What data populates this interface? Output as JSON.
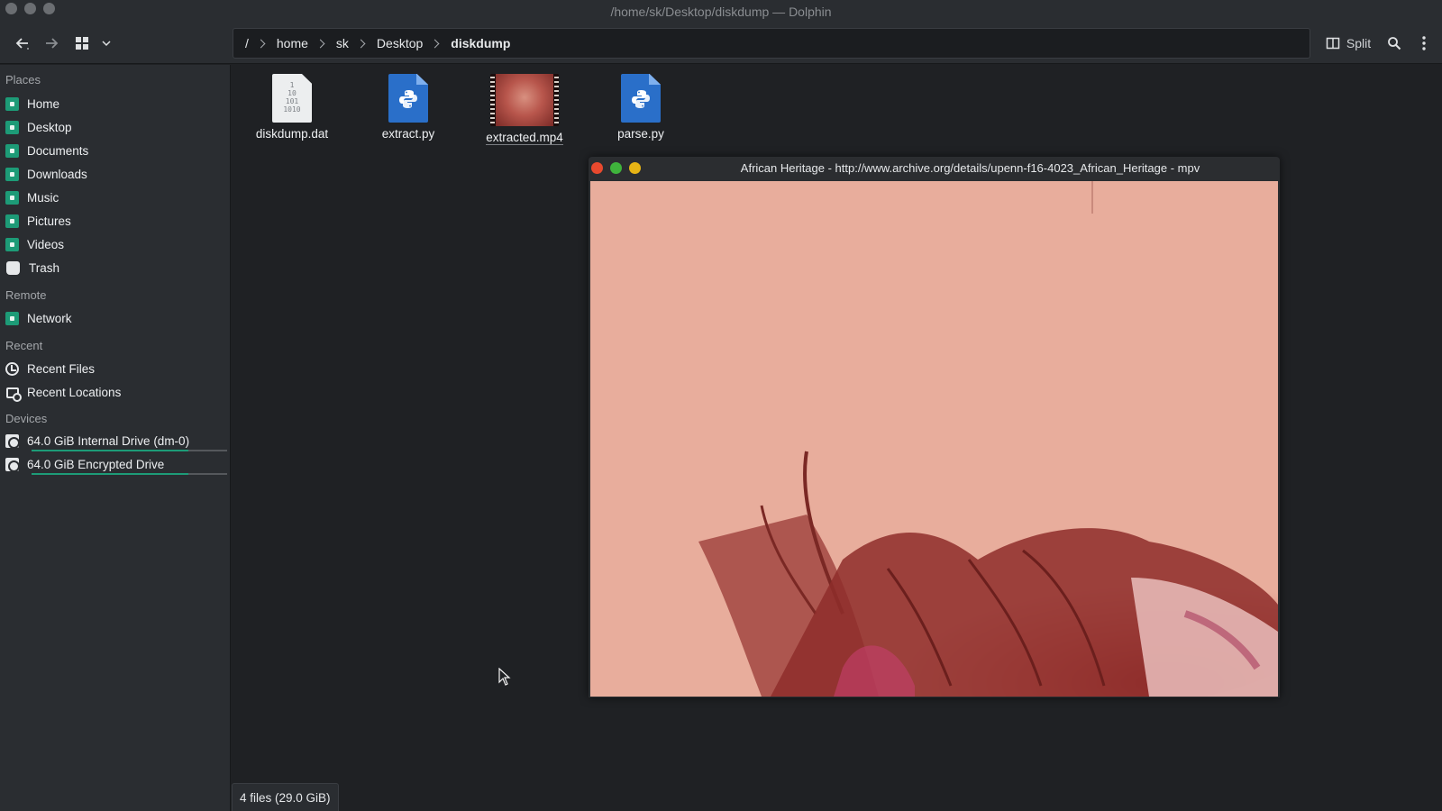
{
  "window": {
    "title": "/home/sk/Desktop/diskdump — Dolphin"
  },
  "toolbar": {
    "back_icon": "arrow-left-icon",
    "forward_icon": "arrow-right-icon",
    "view_icon": "grid-view-icon",
    "split_label": "Split",
    "search_icon": "search-icon",
    "menu_icon": "kebab-menu-icon"
  },
  "breadcrumb": {
    "root": "/",
    "items": [
      "home",
      "sk",
      "Desktop",
      "diskdump"
    ]
  },
  "sidebar": {
    "sections": {
      "places": "Places",
      "remote": "Remote",
      "recent": "Recent",
      "devices": "Devices"
    },
    "places": [
      {
        "label": "Home",
        "icon": "home-folder-icon"
      },
      {
        "label": "Desktop",
        "icon": "desktop-folder-icon"
      },
      {
        "label": "Documents",
        "icon": "documents-folder-icon"
      },
      {
        "label": "Downloads",
        "icon": "downloads-folder-icon"
      },
      {
        "label": "Music",
        "icon": "music-folder-icon"
      },
      {
        "label": "Pictures",
        "icon": "pictures-folder-icon"
      },
      {
        "label": "Videos",
        "icon": "videos-folder-icon"
      },
      {
        "label": "Trash",
        "icon": "trash-icon"
      }
    ],
    "remote": [
      {
        "label": "Network",
        "icon": "network-folder-icon"
      }
    ],
    "recent": [
      {
        "label": "Recent Files",
        "icon": "clock-icon"
      },
      {
        "label": "Recent Locations",
        "icon": "recent-locations-icon"
      }
    ],
    "devices": [
      {
        "label": "64.0 GiB Internal Drive (dm-0)",
        "icon": "drive-icon",
        "usage_fraction": 0.8
      },
      {
        "label": "64.0 GiB Encrypted Drive",
        "icon": "encrypted-drive-icon",
        "usage_fraction": 0.8
      }
    ]
  },
  "files": [
    {
      "name": "diskdump.dat",
      "icon": "binary-file-icon",
      "binary_text": "1\n10\n101\n1010"
    },
    {
      "name": "extract.py",
      "icon": "python-file-icon"
    },
    {
      "name": "extracted.mp4",
      "icon": "video-thumbnail"
    },
    {
      "name": "parse.py",
      "icon": "python-file-icon"
    }
  ],
  "mpv": {
    "title": "African Heritage - http://www.archive.org/details/upenn-f16-4023_African_Heritage - mpv",
    "dot_colors": [
      "#e8492e",
      "#3fb33c",
      "#e7b415"
    ]
  },
  "status": {
    "text": "4 files (29.0 GiB)"
  },
  "colors": {
    "accent": "#1d9b77",
    "window_bg": "#1f2124",
    "panel_bg": "#2a2d31"
  }
}
